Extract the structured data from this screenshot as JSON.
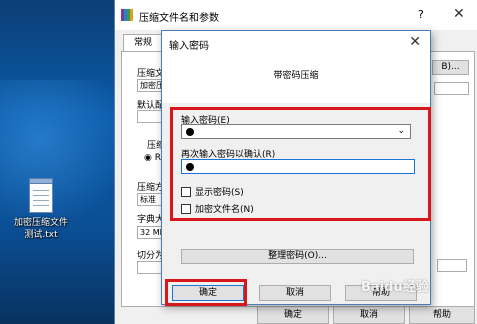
{
  "desktop": {
    "file_label_line1": "加密压缩文件",
    "file_label_line2": "测试.txt"
  },
  "main_window": {
    "title": "压缩文件名和参数",
    "help_glyph": "?",
    "close_glyph": "✕",
    "tab": "常规",
    "labels": {
      "archive_name": "压缩文",
      "archive_value": "加密压",
      "default_profile": "默认配",
      "format_group": "压缩",
      "format_option": "RA",
      "method": "压缩方",
      "method_value": "标准",
      "dictionary": "字典大",
      "dictionary_value": "32 MB",
      "split": "切分为",
      "browse_fragment": "B)..."
    },
    "buttons": {
      "ok": "确定",
      "cancel": "取消",
      "help": "帮助"
    }
  },
  "dialog": {
    "title": "输入密码",
    "close_glyph": "✕",
    "header": "带密码压缩",
    "password_label": "输入密码(E)",
    "confirm_label": "再次输入密码以确认(R)",
    "show_password": "显示密码(S)",
    "encrypt_names": "加密文件名(N)",
    "organize_button": "整理密码(O)...",
    "ok": "确定",
    "cancel": "取消",
    "help": "帮助"
  },
  "watermark": "Baidu经验",
  "colors": {
    "highlight": "#d8161b",
    "focus": "#1b74d6"
  }
}
